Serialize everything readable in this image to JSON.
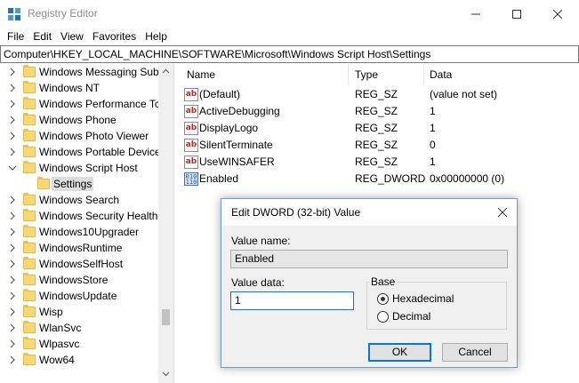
{
  "window": {
    "title": "Registry Editor"
  },
  "menu": [
    "File",
    "Edit",
    "View",
    "Favorites",
    "Help"
  ],
  "address": "Computer\\HKEY_LOCAL_MACHINE\\SOFTWARE\\Microsoft\\Windows Script Host\\Settings",
  "tree": {
    "items": [
      {
        "label": "Windows Messaging Subs"
      },
      {
        "label": "Windows NT"
      },
      {
        "label": "Windows Performance Tc"
      },
      {
        "label": "Windows Phone"
      },
      {
        "label": "Windows Photo Viewer"
      },
      {
        "label": "Windows Portable Device"
      },
      {
        "label": "Windows Script Host",
        "expanded": true
      },
      {
        "label": "Settings",
        "selected": true
      },
      {
        "label": "Windows Search"
      },
      {
        "label": "Windows Security Health"
      },
      {
        "label": "Windows10Upgrader"
      },
      {
        "label": "WindowsRuntime"
      },
      {
        "label": "WindowsSelfHost"
      },
      {
        "label": "WindowsStore"
      },
      {
        "label": "WindowsUpdate"
      },
      {
        "label": "Wisp"
      },
      {
        "label": "WlanSvc"
      },
      {
        "label": "Wlpasvc"
      },
      {
        "label": "Wow64"
      }
    ]
  },
  "list": {
    "columns": {
      "name": "Name",
      "type": "Type",
      "data": "Data"
    },
    "rows": [
      {
        "name": "(Default)",
        "type": "REG_SZ",
        "data": "(value not set)",
        "icon": "string-value-icon"
      },
      {
        "name": "ActiveDebugging",
        "type": "REG_SZ",
        "data": "1",
        "icon": "string-value-icon"
      },
      {
        "name": "DisplayLogo",
        "type": "REG_SZ",
        "data": "1",
        "icon": "string-value-icon"
      },
      {
        "name": "SilentTerminate",
        "type": "REG_SZ",
        "data": "0",
        "icon": "string-value-icon"
      },
      {
        "name": "UseWINSAFER",
        "type": "REG_SZ",
        "data": "1",
        "icon": "string-value-icon"
      },
      {
        "name": "Enabled",
        "type": "REG_DWORD",
        "data": "0x00000000 (0)",
        "icon": "dword-value-icon"
      }
    ]
  },
  "dialog": {
    "title": "Edit DWORD (32-bit) Value",
    "value_name_label": "Value name:",
    "value_name": "Enabled",
    "value_data_label": "Value data:",
    "value_data": "1",
    "base_label": "Base",
    "hex_label": "Hexadecimal",
    "dec_label": "Decimal",
    "base_selected": "Hexadecimal",
    "ok_label": "OK",
    "cancel_label": "Cancel"
  }
}
